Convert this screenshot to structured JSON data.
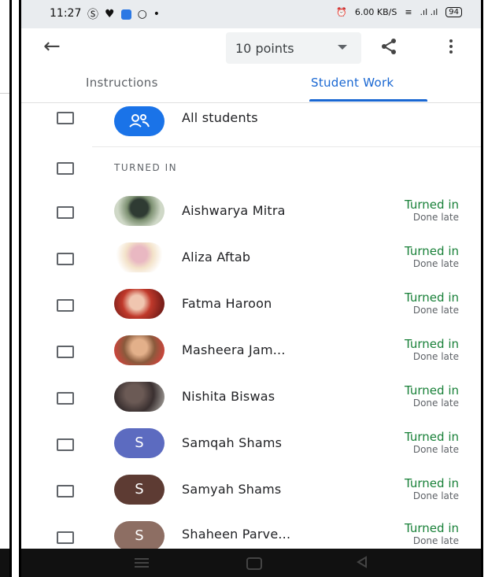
{
  "status_bar": {
    "time": "11:27",
    "speed": "6.00 KB/S",
    "battery": "94"
  },
  "app_bar": {
    "points_label": "10 points"
  },
  "tabs": [
    {
      "label": "Instructions"
    },
    {
      "label": "Student Work"
    }
  ],
  "all_students_label": "All students",
  "section_label": "TURNED IN",
  "students": [
    {
      "name": "Aishwarya Mitra",
      "status": "Turned in",
      "sub": "Done late"
    },
    {
      "name": "Aliza Aftab",
      "status": "Turned in",
      "sub": "Done late"
    },
    {
      "name": "Fatma Haroon",
      "status": "Turned in",
      "sub": "Done late"
    },
    {
      "name": "Masheera Jam...",
      "status": "Turned in",
      "sub": "Done late"
    },
    {
      "name": "Nishita Biswas",
      "status": "Turned in",
      "sub": "Done late"
    },
    {
      "name": "Samqah Shams",
      "status": "Turned in",
      "sub": "Done late",
      "initial": "S"
    },
    {
      "name": "Samyah Shams",
      "status": "Turned in",
      "sub": "Done late",
      "initial": "S"
    },
    {
      "name": "Shaheen Parve...",
      "status": "Turned in",
      "sub": "Done late",
      "initial": "S"
    }
  ],
  "colors": {
    "accent": "#1967d2",
    "turned_in": "#188038"
  }
}
